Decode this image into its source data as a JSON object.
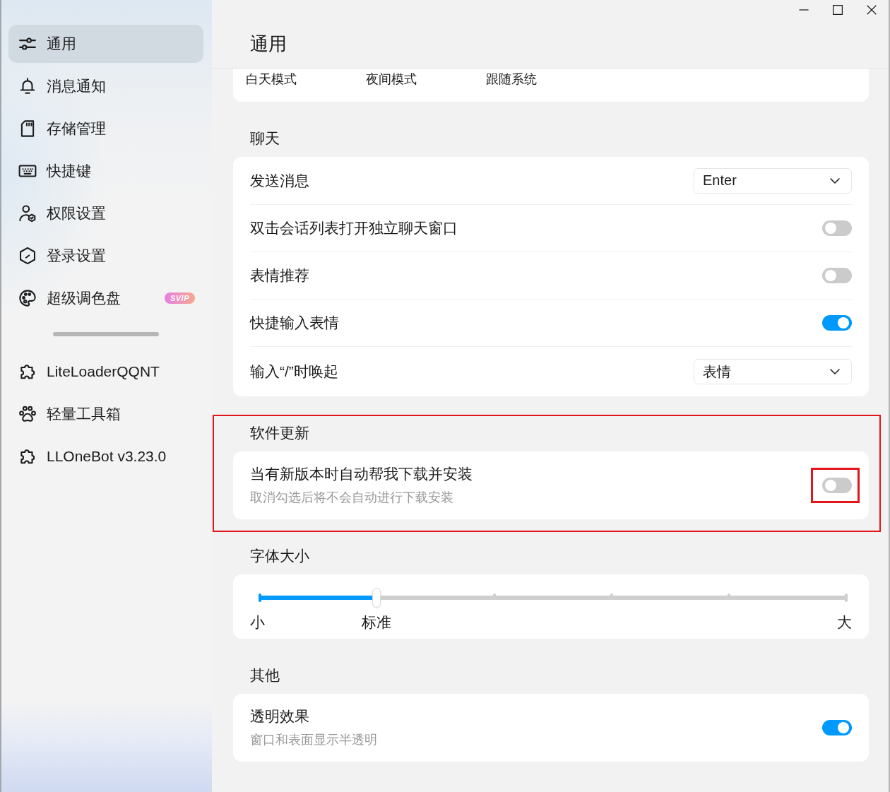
{
  "window": {
    "title": "通用"
  },
  "sidebar": {
    "items": [
      {
        "label": "通用",
        "selected": true
      },
      {
        "label": "消息通知",
        "selected": false
      },
      {
        "label": "存储管理",
        "selected": false
      },
      {
        "label": "快捷键",
        "selected": false
      },
      {
        "label": "权限设置",
        "selected": false
      },
      {
        "label": "登录设置",
        "selected": false
      },
      {
        "label": "超级调色盘",
        "selected": false,
        "badge": "SVIP"
      }
    ],
    "plugins": [
      {
        "label": "LiteLoaderQQNT",
        "selected": false
      },
      {
        "label": "轻量工具箱",
        "selected": false
      },
      {
        "label": "LLOneBot v3.23.0",
        "selected": false
      }
    ]
  },
  "theme_options": [
    "白天模式",
    "夜间模式",
    "跟随系统"
  ],
  "sections": [
    {
      "title": "聊天",
      "highlighted": false,
      "rows": [
        {
          "kind": "select",
          "label": "发送消息",
          "value": "Enter",
          "highlighted": false
        },
        {
          "kind": "toggle",
          "label": "双击会话列表打开独立聊天窗口",
          "on": false,
          "highlighted": false
        },
        {
          "kind": "toggle",
          "label": "表情推荐",
          "on": false,
          "highlighted": false
        },
        {
          "kind": "toggle",
          "label": "快捷输入表情",
          "on": true,
          "highlighted": false
        },
        {
          "kind": "select",
          "label": "输入“/”时唤起",
          "value": "表情",
          "highlighted": false
        }
      ]
    },
    {
      "title": "软件更新",
      "highlighted": true,
      "rows": [
        {
          "kind": "toggle",
          "label": "当有新版本时自动帮我下载并安装",
          "description": "取消勾选后将不会自动进行下载安装",
          "on": false,
          "highlighted": true
        }
      ]
    },
    {
      "title": "字体大小",
      "highlighted": false,
      "rows": [
        {
          "kind": "slider",
          "level": 0.2,
          "highlighted": false,
          "stops": [
            {
              "kind": "end",
              "label": "小"
            },
            {
              "kind": "notch",
              "label": "标准"
            },
            {
              "kind": "notch"
            },
            {
              "kind": "notch"
            },
            {
              "kind": "notch"
            },
            {
              "kind": "end",
              "label": "大"
            }
          ]
        }
      ]
    },
    {
      "title": "其他",
      "highlighted": false,
      "rows": [
        {
          "kind": "toggle",
          "label": "透明效果",
          "description": "窗口和表面显示半透明",
          "on": true,
          "highlighted": false
        }
      ]
    }
  ]
}
